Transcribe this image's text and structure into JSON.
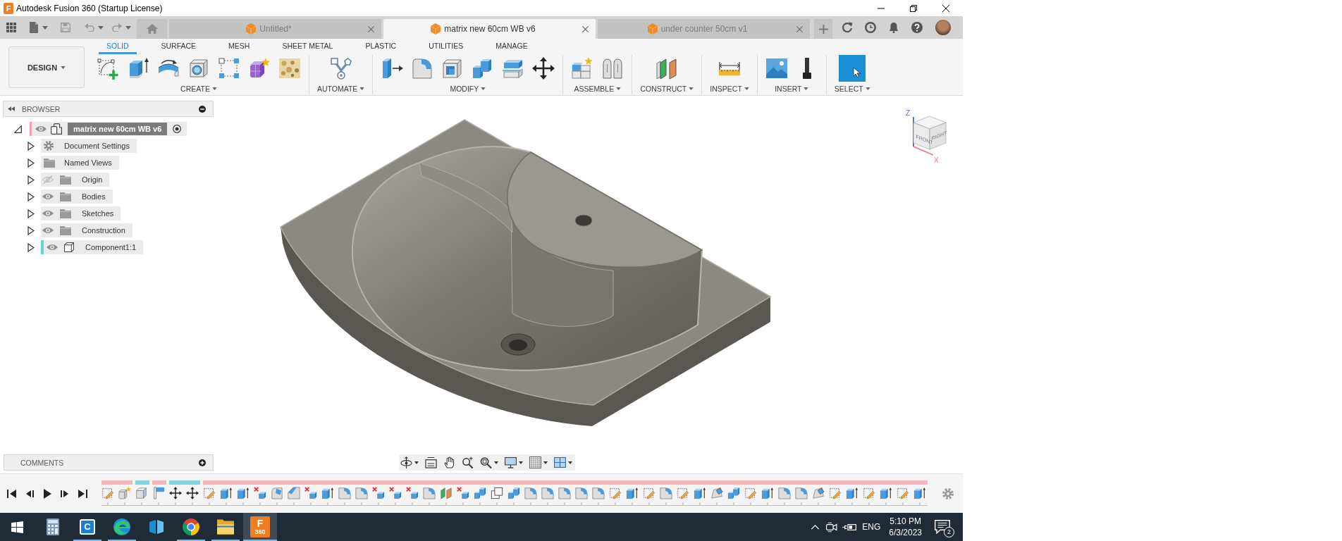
{
  "window": {
    "icon_letter": "F",
    "title": "Autodesk Fusion 360 (Startup License)"
  },
  "doc_tabs": [
    {
      "label": "Untitled*",
      "selected": false
    },
    {
      "label": "matrix new 60cm WB v6",
      "selected": true
    },
    {
      "label": "under counter 50cm v1",
      "selected": false
    }
  ],
  "workspace": {
    "label": "DESIGN"
  },
  "toolbar_tabs": [
    {
      "label": "SOLID",
      "selected": true
    },
    {
      "label": "SURFACE",
      "selected": false
    },
    {
      "label": "MESH",
      "selected": false
    },
    {
      "label": "SHEET METAL",
      "selected": false
    },
    {
      "label": "PLASTIC",
      "selected": false
    },
    {
      "label": "UTILITIES",
      "selected": false
    },
    {
      "label": "MANAGE",
      "selected": false
    }
  ],
  "toolbar_groups": [
    {
      "kind": "create",
      "label": "CREATE"
    },
    {
      "kind": "automate",
      "label": "AUTOMATE"
    },
    {
      "kind": "modify",
      "label": "MODIFY"
    },
    {
      "kind": "assemble",
      "label": "ASSEMBLE"
    },
    {
      "kind": "construct",
      "label": "CONSTRUCT"
    },
    {
      "kind": "inspect",
      "label": "INSPECT"
    },
    {
      "kind": "insert",
      "label": "INSERT"
    },
    {
      "kind": "select",
      "label": "SELECT"
    }
  ],
  "browser": {
    "title": "BROWSER",
    "root": {
      "label": "matrix new 60cm WB v6",
      "expanded": true,
      "active": true,
      "visible": true,
      "color": "#f0a4aa",
      "children": [
        {
          "kind": "settings",
          "label": "Document Settings",
          "expanded": false
        },
        {
          "kind": "views",
          "label": "Named Views",
          "expanded": false
        },
        {
          "kind": "folder",
          "label": "Origin",
          "expanded": false,
          "visible": false
        },
        {
          "kind": "folder",
          "label": "Bodies",
          "expanded": false,
          "visible": true
        },
        {
          "kind": "folder",
          "label": "Sketches",
          "expanded": false,
          "visible": true
        },
        {
          "kind": "folder",
          "label": "Construction",
          "expanded": false,
          "visible": true
        },
        {
          "kind": "component",
          "label": "Component1:1",
          "expanded": false,
          "visible": true,
          "color": "#6ccfd6"
        }
      ]
    }
  },
  "view_cube": {
    "faces": [
      "FRONT",
      "RIGHT"
    ],
    "axes": [
      "Z",
      "X"
    ]
  },
  "comments": {
    "title": "COMMENTS"
  },
  "taskbar": {
    "apps": [
      {
        "kind": "calculator",
        "running": false,
        "selected": false
      },
      {
        "kind": "tile",
        "logo_text": "C",
        "running": true,
        "selected": false
      },
      {
        "kind": "wave",
        "running": true,
        "selected": false
      },
      {
        "kind": "bracket",
        "running": false,
        "selected": false
      },
      {
        "kind": "ring",
        "running": true,
        "selected": false
      },
      {
        "kind": "folder",
        "running": true,
        "selected": false
      },
      {
        "kind": "fusion",
        "logo_text": "F",
        "logo_caption": "360",
        "running": true,
        "selected": true
      }
    ],
    "language": "ENG",
    "time": "5:10 PM",
    "date": "6/3/2023",
    "notifications": "2"
  }
}
